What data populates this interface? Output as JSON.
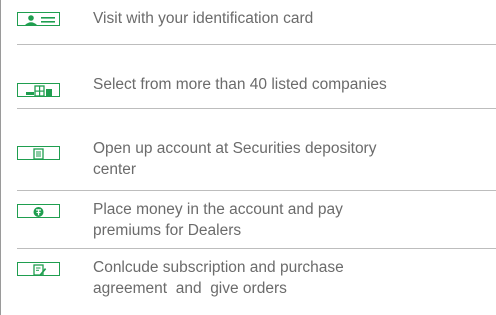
{
  "accent_color": "#1f9e4f",
  "text_color": "#6b6b6b",
  "steps": [
    {
      "icon": "id-card-icon",
      "text": "Visit with your identification card"
    },
    {
      "icon": "buildings-icon",
      "text": "Select from more than 40 listed companies"
    },
    {
      "icon": "document-icon",
      "text": "Open up account at Securities depository\ncenter"
    },
    {
      "icon": "money-icon",
      "text": "Place money in the account and pay\npremiums for Dealers"
    },
    {
      "icon": "contract-icon",
      "text": "Conlcude subscription and purchase\nagreement  and  give orders"
    }
  ]
}
